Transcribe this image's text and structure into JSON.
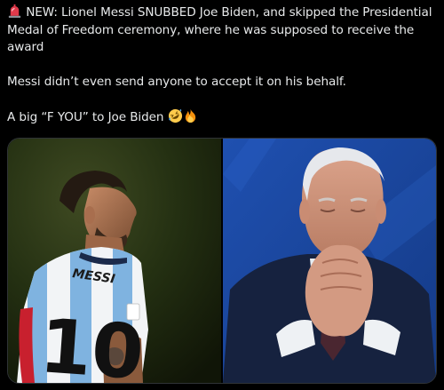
{
  "post": {
    "line1_emoji": "police-light-emoji",
    "line1_text": "NEW: Lionel Messi SNUBBED Joe Biden, and skipped the Presidential Medal of Freedom ceremony, where he was supposed to receive the award",
    "line2_text": "Messi didn’t even send anyone to accept it on his behalf.",
    "line3_text": "A big “F YOU” to Joe Biden",
    "line3_emojis": [
      "rolling-laughing-emoji",
      "fire-emoji"
    ]
  },
  "media": {
    "images": [
      {
        "subject": "messi-photo",
        "jersey_name": "MESSI",
        "jersey_number": "10"
      },
      {
        "subject": "biden-photo"
      }
    ]
  },
  "colors": {
    "background": "#000000",
    "text": "#e7e9ea",
    "border": "#2f3336",
    "jersey_sky_blue": "#7fb3e0",
    "right_photo_blue": "#1d4fa8"
  }
}
